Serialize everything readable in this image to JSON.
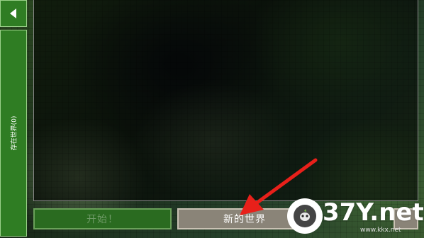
{
  "sidebar": {
    "back_icon": "back-triangle-icon",
    "existing_worlds_label": "存在世界(0)"
  },
  "buttons": {
    "start_label": "开始！",
    "new_world_label": "新的世界"
  },
  "watermark": {
    "logo_text": "37Y.net",
    "sub_text": "www.kkx.net"
  },
  "colors": {
    "sidebar_green": "#2f7d23",
    "arrow_red": "#e8201a",
    "button_gray": "#8a8478"
  }
}
